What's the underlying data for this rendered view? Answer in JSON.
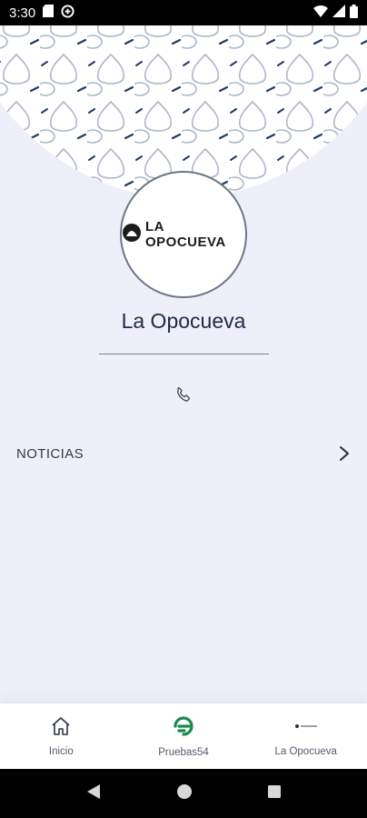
{
  "status_bar": {
    "time": "3:30",
    "icons": [
      "sd-card-icon",
      "data-saver-icon",
      "wifi-icon",
      "signal-icon",
      "battery-icon"
    ]
  },
  "profile": {
    "logo_text": "LA OPOCUEVA",
    "name": "La Opocueva"
  },
  "menu": {
    "items": [
      {
        "label": "NOTICIAS",
        "icon": "chevron-right-icon"
      }
    ]
  },
  "bottom_nav": {
    "items": [
      {
        "label": "Inicio",
        "icon": "home-icon"
      },
      {
        "label": "Pruebas54",
        "icon": "pruebas54-logo-icon"
      },
      {
        "label": "La Opocueva",
        "icon": "opocueva-logo-icon"
      }
    ]
  },
  "colors": {
    "background": "#eeeff9",
    "title": "#1f2a44",
    "accent_green": "#1a8a4a",
    "pattern_navy": "#1f3a6b"
  }
}
